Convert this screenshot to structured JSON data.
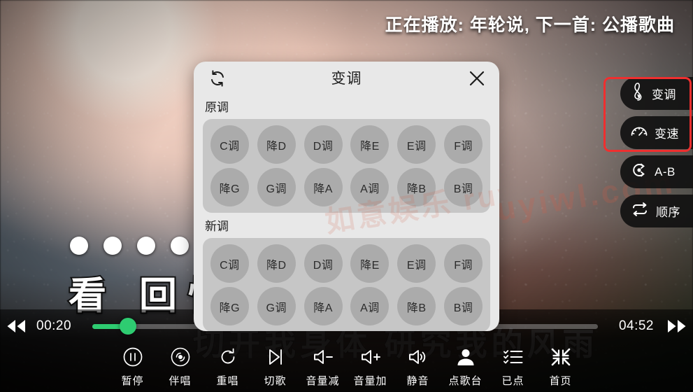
{
  "now_playing": "正在播放: 年轮说, 下一首: 公播歌曲",
  "lyrics": {
    "current_line": "看 回忆",
    "next_line": "切开我身体 研究我的风雨"
  },
  "watermark": "如意娱乐 ruyiwl.com",
  "colors": {
    "accent_green": "#2ecc71",
    "highlight_red": "#ef2f2f",
    "modal_bg": "#e8e8e8",
    "key_panel_bg": "#c6c6c6",
    "key_bg": "#ababab"
  },
  "rail": {
    "items": [
      {
        "label": "变调",
        "icon": "treble-clef-icon",
        "highlighted": true
      },
      {
        "label": "变速",
        "icon": "speedometer-icon",
        "highlighted": true
      },
      {
        "label": "A-B",
        "icon": "ab-repeat-icon",
        "highlighted": false
      },
      {
        "label": "顺序",
        "icon": "repeat-icon",
        "highlighted": false
      }
    ]
  },
  "player": {
    "current_time": "00:20",
    "total_time": "04:52",
    "progress_percent": 7,
    "rewind_icon": "rewind-icon",
    "forward_icon": "fast-forward-icon"
  },
  "bottom_nav": {
    "items": [
      {
        "label": "暂停",
        "icon": "pause-icon"
      },
      {
        "label": "伴唱",
        "icon": "accompaniment-icon"
      },
      {
        "label": "重唱",
        "icon": "replay-icon"
      },
      {
        "label": "切歌",
        "icon": "next-track-icon"
      },
      {
        "label": "音量减",
        "icon": "volume-down-icon"
      },
      {
        "label": "音量加",
        "icon": "volume-up-icon"
      },
      {
        "label": "静音",
        "icon": "mute-icon"
      },
      {
        "label": "点歌台",
        "icon": "person-icon"
      },
      {
        "label": "已点",
        "icon": "checklist-icon"
      },
      {
        "label": "首页",
        "icon": "home-compress-icon"
      }
    ]
  },
  "modal": {
    "title": "变调",
    "reset_icon": "refresh-icon",
    "close_icon": "close-icon",
    "sections": [
      {
        "label": "原调",
        "keys": [
          "C调",
          "降D",
          "D调",
          "降E",
          "E调",
          "F调",
          "降G",
          "G调",
          "降A",
          "A调",
          "降B",
          "B调"
        ]
      },
      {
        "label": "新调",
        "keys": [
          "C调",
          "降D",
          "D调",
          "降E",
          "E调",
          "F调",
          "降G",
          "G调",
          "降A",
          "A调",
          "降B",
          "B调"
        ]
      }
    ]
  }
}
